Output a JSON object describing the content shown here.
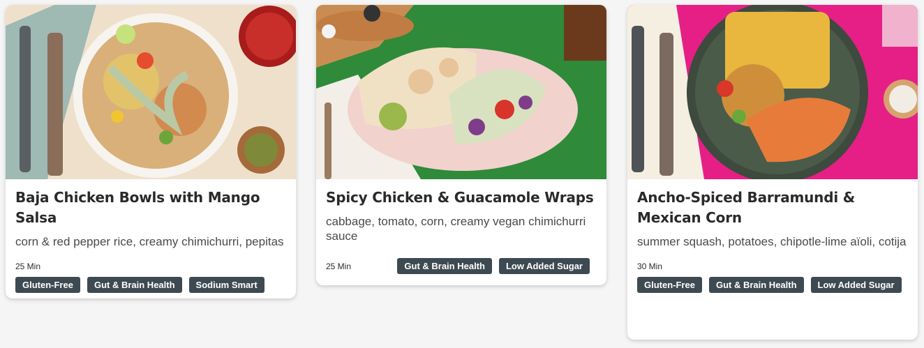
{
  "recipes": [
    {
      "title": "Baja Chicken Bowls with Mango Salsa",
      "description": "corn & red pepper rice, creamy chimichurri, pepitas",
      "time": "25 Min",
      "tags": [
        "Gluten-Free",
        "Gut & Brain Health",
        "Sodium Smart"
      ]
    },
    {
      "title": "Spicy Chicken & Guacamole Wraps",
      "description": "cabbage, tomato, corn, creamy vegan chimichurri sauce",
      "time": "25 Min",
      "tags": [
        "Gut & Brain Health",
        "Low Added Sugar"
      ]
    },
    {
      "title": "Ancho-Spiced Barramundi & Mexican Corn",
      "description": "summer squash, potatoes, chipotle-lime aïoli, cotija",
      "time": "30 Min",
      "tags": [
        "Gluten-Free",
        "Gut & Brain Health",
        "Low Added Sugar"
      ]
    }
  ],
  "colors": {
    "tag_bg": "#3e4a52",
    "card_bg": "#ffffff",
    "page_bg": "#f5f5f5"
  }
}
